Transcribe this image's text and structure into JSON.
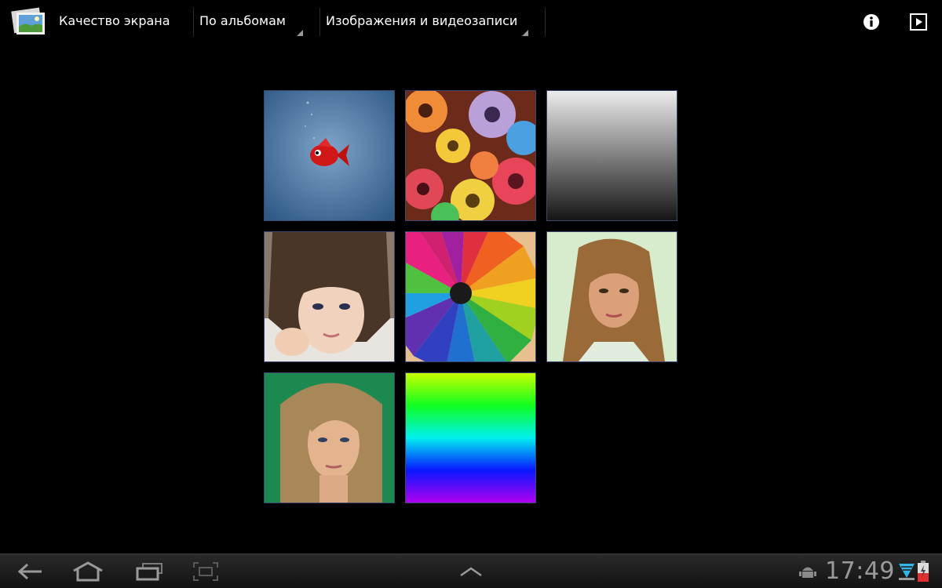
{
  "actionbar": {
    "app_icon": "gallery-icon",
    "title": "Качество экрана",
    "spinner_album_mode": "По альбомам",
    "spinner_media_type": "Изображения и видеозаписи",
    "info_icon": "info-icon",
    "slideshow_icon": "play-icon"
  },
  "grid": {
    "items": [
      {
        "subject": "red-fish-photo"
      },
      {
        "subject": "fruit-cereal-rings-photo"
      },
      {
        "subject": "gray-gradient"
      },
      {
        "subject": "woman-portrait-photo"
      },
      {
        "subject": "colored-pencils-photo"
      },
      {
        "subject": "woman-portrait-photo"
      },
      {
        "subject": "woman-portrait-photo"
      },
      {
        "subject": "rainbow-gradient"
      }
    ]
  },
  "systembar": {
    "back_icon": "back-icon",
    "home_icon": "home-icon",
    "recents_icon": "recent-apps-icon",
    "screenshot_icon": "screenshot-icon",
    "menu_icon": "chevron-up-icon",
    "debug_icon": "android-icon",
    "clock": "17:49",
    "wifi_icon": "wifi-icon",
    "battery_icon": "battery-icon"
  },
  "colors": {
    "background": "#000000",
    "tile_border": "#3d4870",
    "systembar_text": "#9a9a9a"
  }
}
